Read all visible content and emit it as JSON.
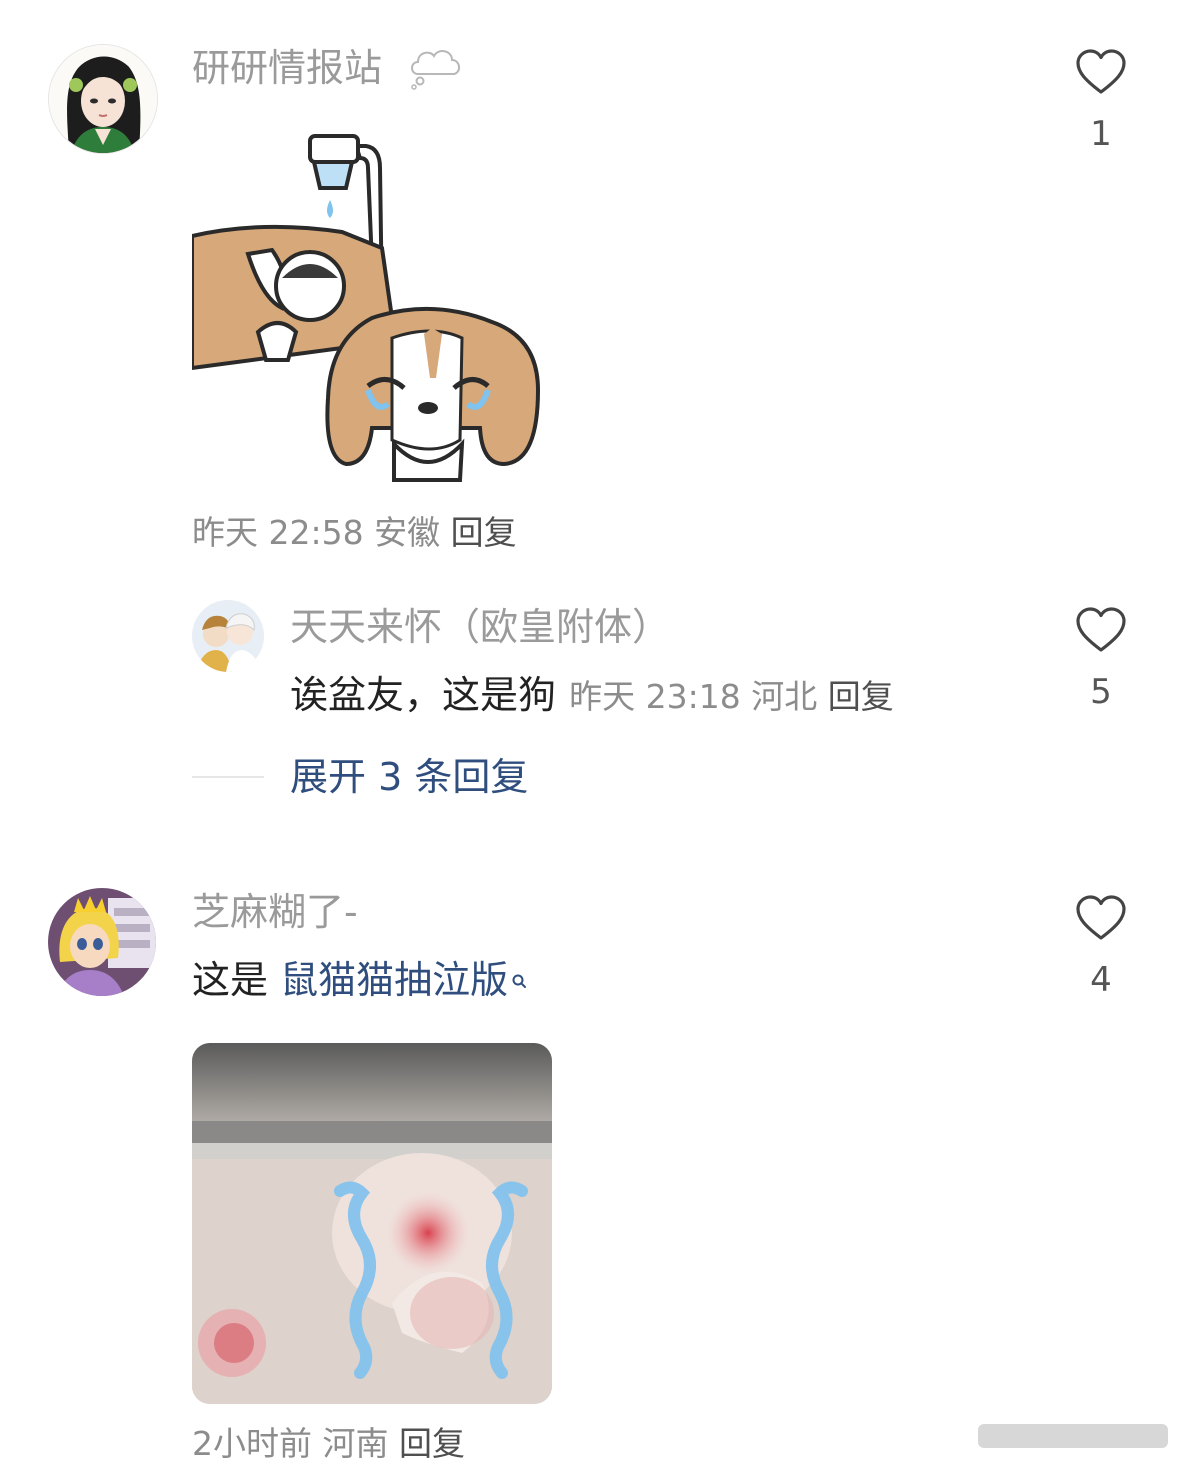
{
  "comments": [
    {
      "username": "研研情报站",
      "badge_icon": "thought-bubble-icon",
      "image_alt": "crying-dog-sticker",
      "time": "昨天 22:58",
      "location": "安徽",
      "reply_label": "回复",
      "likes": "1",
      "replies": [
        {
          "username": "天天来怀（欧皇附体）",
          "text": "诶盆友，这是狗",
          "time": "昨天 23:18",
          "location": "河北",
          "reply_label": "回复",
          "likes": "5"
        }
      ],
      "expand_label": "展开 3 条回复"
    },
    {
      "username": "芝麻糊了-",
      "text_prefix": "这是 ",
      "text_link": "鼠猫猫抽泣版",
      "image_alt": "crying-mouse-photo",
      "time": "2小时前",
      "location": "河南",
      "reply_label": "回复",
      "likes": "4"
    }
  ],
  "colors": {
    "link": "#2f4e7e",
    "username": "#9a9a9a",
    "meta": "#8c8c8c"
  }
}
